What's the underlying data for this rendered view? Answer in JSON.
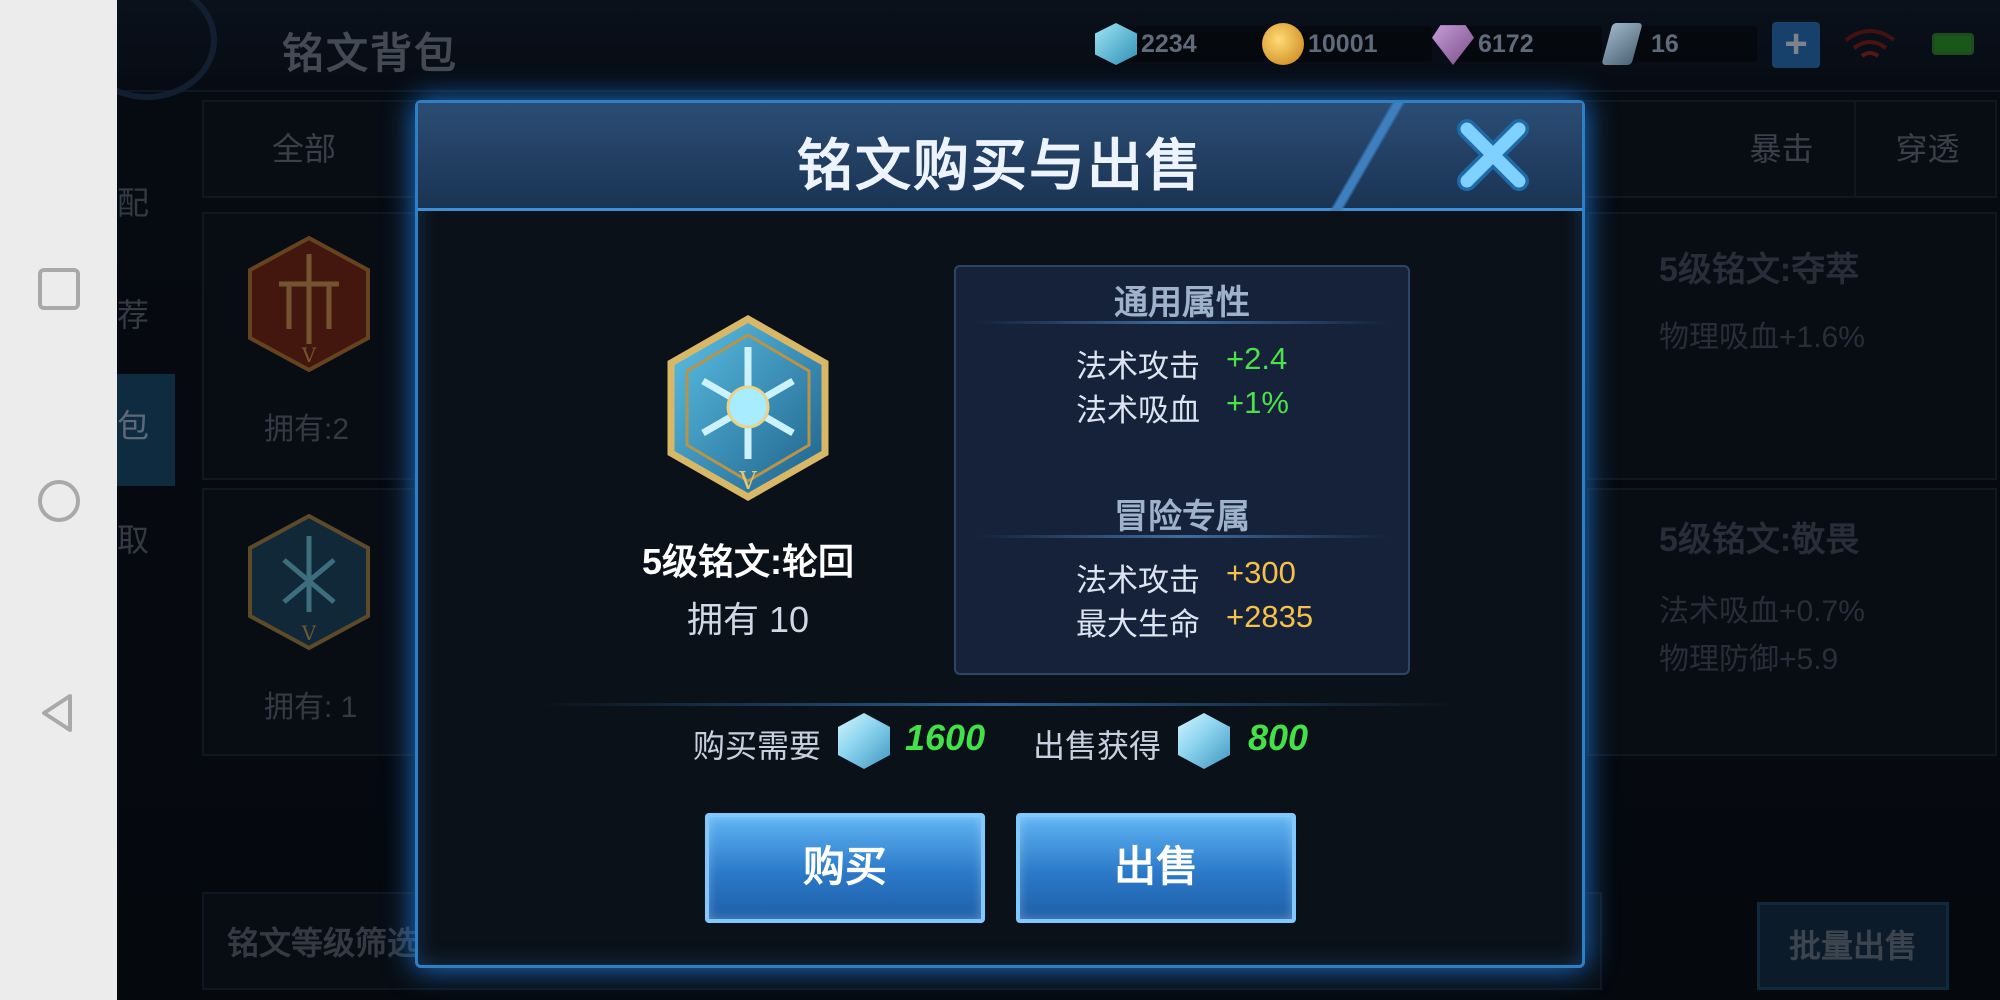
{
  "page": {
    "title": "铭文背包",
    "resources": [
      {
        "name": "gem",
        "value": "2234"
      },
      {
        "name": "coin",
        "value": "10001"
      },
      {
        "name": "diamond",
        "value": "6172"
      },
      {
        "name": "ticket",
        "value": "16"
      }
    ],
    "tabs": {
      "all": "全部",
      "crit": "暴击",
      "pierce": "穿透"
    },
    "side_menu": {
      "item1": "搭配",
      "item2": "推荐",
      "item3": "背包",
      "item4": "获取"
    },
    "cards": {
      "left1_owned": "拥有:2",
      "left2_owned": "拥有: 1",
      "right1_title": "5级铭文:夺萃",
      "right1_stat1": "物理吸血+1.6%",
      "right2_title": "5级铭文:敬畏",
      "right2_stat1": "法术吸血+0.7%",
      "right2_stat2": "物理防御+5.9"
    },
    "filter_label": "铭文等级筛选",
    "batch_sell": "批量出售"
  },
  "modal": {
    "title": "铭文购买与出售",
    "rune_name": "5级铭文:轮回",
    "owned": "拥有 10",
    "general_header": "通用属性",
    "general": [
      {
        "label": "法术攻击",
        "value": "+2.4"
      },
      {
        "label": "法术吸血",
        "value": "+1%"
      }
    ],
    "adventure_header": "冒险专属",
    "adventure": [
      {
        "label": "法术攻击",
        "value": "+300"
      },
      {
        "label": "最大生命",
        "value": "+2835"
      }
    ],
    "buy_label": "购买需要",
    "buy_price": "1600",
    "sell_label": "出售获得",
    "sell_price": "800",
    "buy_button": "购买",
    "sell_button": "出售"
  },
  "colors": {
    "accent": "#2f7fc4",
    "green_value": "#4ce14a",
    "gold_value": "#f5c14a"
  }
}
